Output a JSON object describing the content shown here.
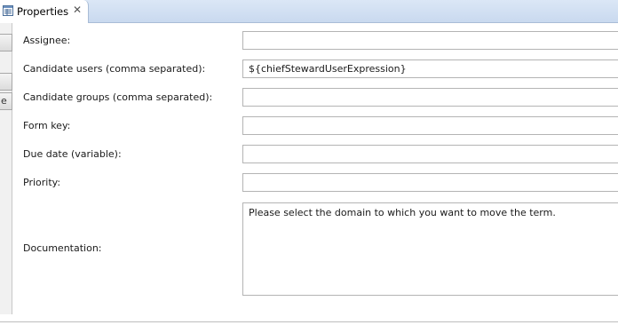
{
  "tab": {
    "label": "Properties",
    "icon": "properties-icon",
    "close": "✕"
  },
  "left_strip": {
    "button3_fragment": "e"
  },
  "form": {
    "assignee": {
      "label": "Assignee:",
      "value": ""
    },
    "candidate_users": {
      "label": "Candidate users (comma separated):",
      "value": "${chiefStewardUserExpression}"
    },
    "candidate_groups": {
      "label": "Candidate groups (comma separated):",
      "value": ""
    },
    "form_key": {
      "label": "Form key:",
      "value": ""
    },
    "due_date": {
      "label": "Due date (variable):",
      "value": ""
    },
    "priority": {
      "label": "Priority:",
      "value": ""
    },
    "documentation": {
      "label": "Documentation:",
      "value": "Please select the domain to which you want to move the term."
    }
  },
  "colors": {
    "tabbar": "#c9d9ef",
    "field_border": "#b4b4b4"
  }
}
